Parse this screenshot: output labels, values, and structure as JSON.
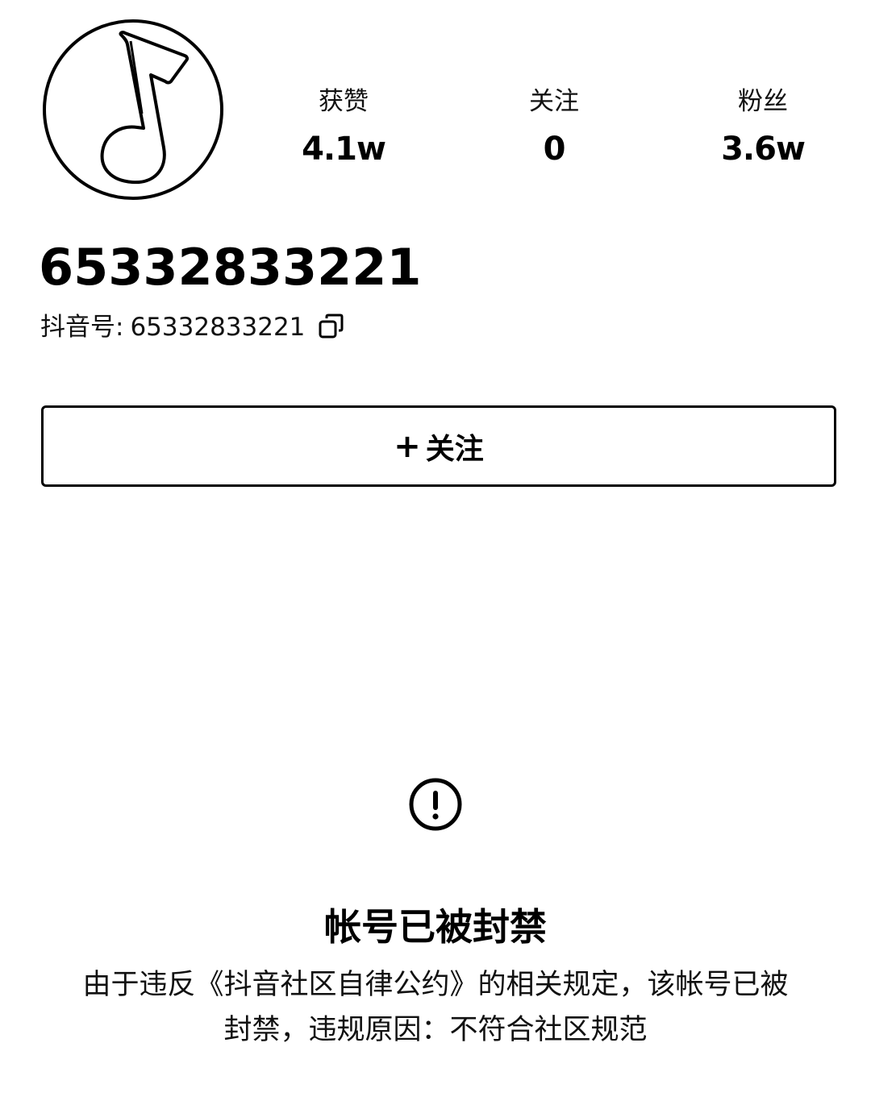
{
  "profile": {
    "avatar_icon": "music-note-icon",
    "nickname": "65332833221",
    "account_label": "抖音号:",
    "account_id": "65332833221",
    "copy_icon": "copy-icon"
  },
  "stats": {
    "likes_label": "获赞",
    "likes_value": "4.1w",
    "following_label": "关注",
    "following_value": "0",
    "fans_label": "粉丝",
    "fans_value": "3.6w"
  },
  "follow_button": {
    "plus": "+",
    "label": "关注"
  },
  "ban_notice": {
    "icon": "exclamation-circle-icon",
    "title": "帐号已被封禁",
    "description": "由于违反《抖音社区自律公约》的相关规定，该帐号已被封禁，违规原因：不符合社区规范"
  }
}
